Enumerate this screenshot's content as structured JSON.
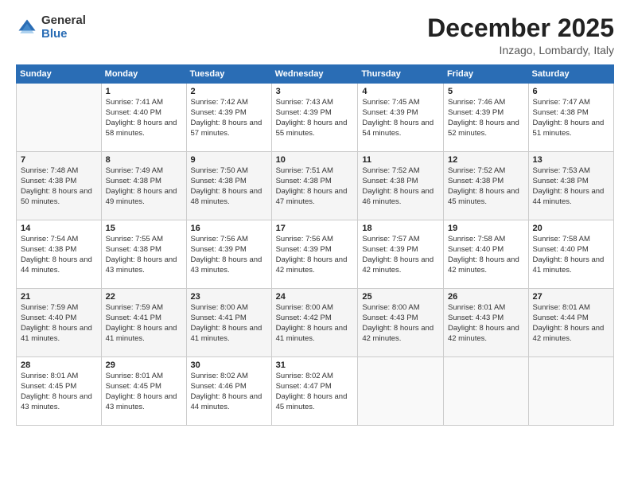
{
  "logo": {
    "general": "General",
    "blue": "Blue"
  },
  "header": {
    "month": "December 2025",
    "location": "Inzago, Lombardy, Italy"
  },
  "days_of_week": [
    "Sunday",
    "Monday",
    "Tuesday",
    "Wednesday",
    "Thursday",
    "Friday",
    "Saturday"
  ],
  "weeks": [
    [
      {
        "day": "",
        "sunrise": "",
        "sunset": "",
        "daylight": ""
      },
      {
        "day": "1",
        "sunrise": "Sunrise: 7:41 AM",
        "sunset": "Sunset: 4:40 PM",
        "daylight": "Daylight: 8 hours and 58 minutes."
      },
      {
        "day": "2",
        "sunrise": "Sunrise: 7:42 AM",
        "sunset": "Sunset: 4:39 PM",
        "daylight": "Daylight: 8 hours and 57 minutes."
      },
      {
        "day": "3",
        "sunrise": "Sunrise: 7:43 AM",
        "sunset": "Sunset: 4:39 PM",
        "daylight": "Daylight: 8 hours and 55 minutes."
      },
      {
        "day": "4",
        "sunrise": "Sunrise: 7:45 AM",
        "sunset": "Sunset: 4:39 PM",
        "daylight": "Daylight: 8 hours and 54 minutes."
      },
      {
        "day": "5",
        "sunrise": "Sunrise: 7:46 AM",
        "sunset": "Sunset: 4:39 PM",
        "daylight": "Daylight: 8 hours and 52 minutes."
      },
      {
        "day": "6",
        "sunrise": "Sunrise: 7:47 AM",
        "sunset": "Sunset: 4:38 PM",
        "daylight": "Daylight: 8 hours and 51 minutes."
      }
    ],
    [
      {
        "day": "7",
        "sunrise": "Sunrise: 7:48 AM",
        "sunset": "Sunset: 4:38 PM",
        "daylight": "Daylight: 8 hours and 50 minutes."
      },
      {
        "day": "8",
        "sunrise": "Sunrise: 7:49 AM",
        "sunset": "Sunset: 4:38 PM",
        "daylight": "Daylight: 8 hours and 49 minutes."
      },
      {
        "day": "9",
        "sunrise": "Sunrise: 7:50 AM",
        "sunset": "Sunset: 4:38 PM",
        "daylight": "Daylight: 8 hours and 48 minutes."
      },
      {
        "day": "10",
        "sunrise": "Sunrise: 7:51 AM",
        "sunset": "Sunset: 4:38 PM",
        "daylight": "Daylight: 8 hours and 47 minutes."
      },
      {
        "day": "11",
        "sunrise": "Sunrise: 7:52 AM",
        "sunset": "Sunset: 4:38 PM",
        "daylight": "Daylight: 8 hours and 46 minutes."
      },
      {
        "day": "12",
        "sunrise": "Sunrise: 7:52 AM",
        "sunset": "Sunset: 4:38 PM",
        "daylight": "Daylight: 8 hours and 45 minutes."
      },
      {
        "day": "13",
        "sunrise": "Sunrise: 7:53 AM",
        "sunset": "Sunset: 4:38 PM",
        "daylight": "Daylight: 8 hours and 44 minutes."
      }
    ],
    [
      {
        "day": "14",
        "sunrise": "Sunrise: 7:54 AM",
        "sunset": "Sunset: 4:38 PM",
        "daylight": "Daylight: 8 hours and 44 minutes."
      },
      {
        "day": "15",
        "sunrise": "Sunrise: 7:55 AM",
        "sunset": "Sunset: 4:38 PM",
        "daylight": "Daylight: 8 hours and 43 minutes."
      },
      {
        "day": "16",
        "sunrise": "Sunrise: 7:56 AM",
        "sunset": "Sunset: 4:39 PM",
        "daylight": "Daylight: 8 hours and 43 minutes."
      },
      {
        "day": "17",
        "sunrise": "Sunrise: 7:56 AM",
        "sunset": "Sunset: 4:39 PM",
        "daylight": "Daylight: 8 hours and 42 minutes."
      },
      {
        "day": "18",
        "sunrise": "Sunrise: 7:57 AM",
        "sunset": "Sunset: 4:39 PM",
        "daylight": "Daylight: 8 hours and 42 minutes."
      },
      {
        "day": "19",
        "sunrise": "Sunrise: 7:58 AM",
        "sunset": "Sunset: 4:40 PM",
        "daylight": "Daylight: 8 hours and 42 minutes."
      },
      {
        "day": "20",
        "sunrise": "Sunrise: 7:58 AM",
        "sunset": "Sunset: 4:40 PM",
        "daylight": "Daylight: 8 hours and 41 minutes."
      }
    ],
    [
      {
        "day": "21",
        "sunrise": "Sunrise: 7:59 AM",
        "sunset": "Sunset: 4:40 PM",
        "daylight": "Daylight: 8 hours and 41 minutes."
      },
      {
        "day": "22",
        "sunrise": "Sunrise: 7:59 AM",
        "sunset": "Sunset: 4:41 PM",
        "daylight": "Daylight: 8 hours and 41 minutes."
      },
      {
        "day": "23",
        "sunrise": "Sunrise: 8:00 AM",
        "sunset": "Sunset: 4:41 PM",
        "daylight": "Daylight: 8 hours and 41 minutes."
      },
      {
        "day": "24",
        "sunrise": "Sunrise: 8:00 AM",
        "sunset": "Sunset: 4:42 PM",
        "daylight": "Daylight: 8 hours and 41 minutes."
      },
      {
        "day": "25",
        "sunrise": "Sunrise: 8:00 AM",
        "sunset": "Sunset: 4:43 PM",
        "daylight": "Daylight: 8 hours and 42 minutes."
      },
      {
        "day": "26",
        "sunrise": "Sunrise: 8:01 AM",
        "sunset": "Sunset: 4:43 PM",
        "daylight": "Daylight: 8 hours and 42 minutes."
      },
      {
        "day": "27",
        "sunrise": "Sunrise: 8:01 AM",
        "sunset": "Sunset: 4:44 PM",
        "daylight": "Daylight: 8 hours and 42 minutes."
      }
    ],
    [
      {
        "day": "28",
        "sunrise": "Sunrise: 8:01 AM",
        "sunset": "Sunset: 4:45 PM",
        "daylight": "Daylight: 8 hours and 43 minutes."
      },
      {
        "day": "29",
        "sunrise": "Sunrise: 8:01 AM",
        "sunset": "Sunset: 4:45 PM",
        "daylight": "Daylight: 8 hours and 43 minutes."
      },
      {
        "day": "30",
        "sunrise": "Sunrise: 8:02 AM",
        "sunset": "Sunset: 4:46 PM",
        "daylight": "Daylight: 8 hours and 44 minutes."
      },
      {
        "day": "31",
        "sunrise": "Sunrise: 8:02 AM",
        "sunset": "Sunset: 4:47 PM",
        "daylight": "Daylight: 8 hours and 45 minutes."
      },
      {
        "day": "",
        "sunrise": "",
        "sunset": "",
        "daylight": ""
      },
      {
        "day": "",
        "sunrise": "",
        "sunset": "",
        "daylight": ""
      },
      {
        "day": "",
        "sunrise": "",
        "sunset": "",
        "daylight": ""
      }
    ]
  ]
}
